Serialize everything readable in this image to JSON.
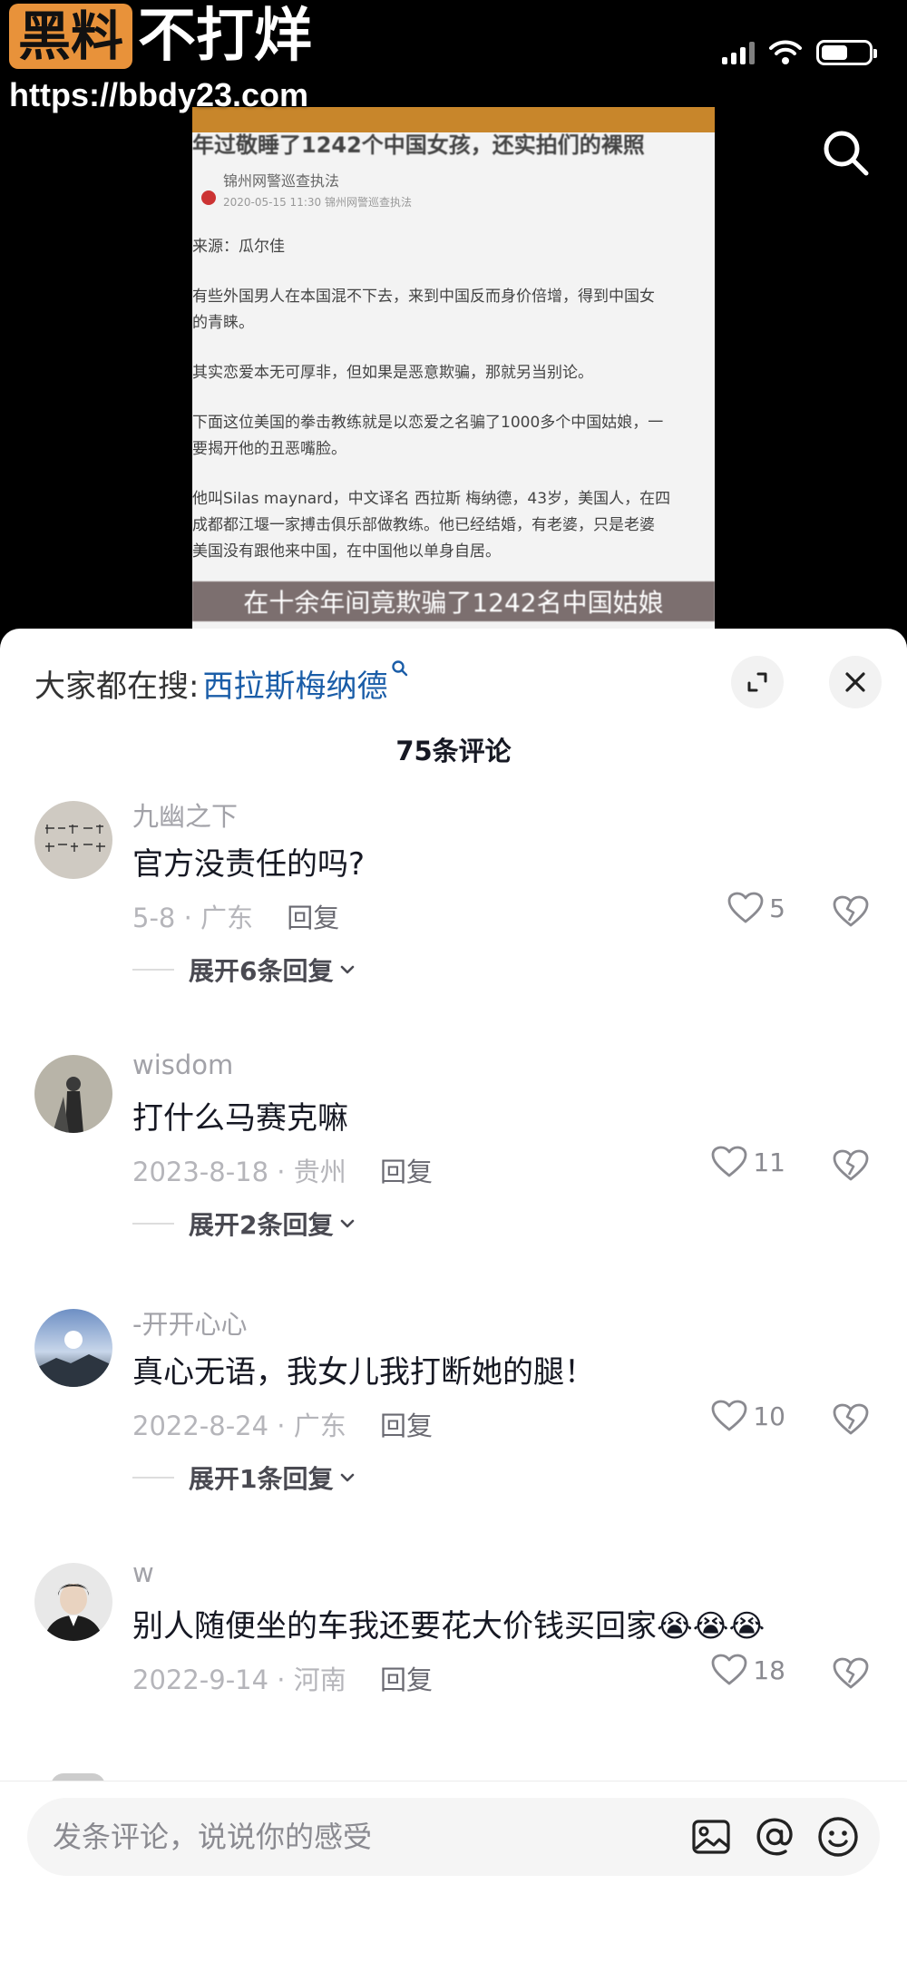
{
  "watermark": {
    "badge": "黑料",
    "brand": "不打烊",
    "url": "https://bbdy23.com"
  },
  "video": {
    "article": {
      "headline": "年过敬睡了1242个中国女孩，还实拍们的裸照",
      "author": "锦州网警巡查执法",
      "date": "2020-05-15 11:30    锦州网警巡查执法",
      "paragraphs": [
        "来源：瓜尔佳",
        "有些外国男人在本国混不下去，来到中国反而身价倍增，得到中国女",
        "的青睐。",
        "其实恋爱本无可厚非，但如果是恶意欺骗，那就另当别论。",
        "下面这位美国的拳击教练就是以恋爱之名骗了1000多个中国姑娘，一",
        "要揭开他的丑恶嘴脸。",
        "他叫Silas maynard，中文译名 西拉斯 梅纳德，43岁，美国人，在四",
        "成都都江堰一家搏击俱乐部做教练。他已经结婚，有老婆，只是老婆",
        "美国没有跟他来中国，在中国他以单身自居。"
      ],
      "caption": "在十余年间竟欺骗了1242名中国姑娘"
    }
  },
  "sheet": {
    "hot_search_label": "大家都在搜:",
    "hot_search_keyword": "西拉斯梅纳德",
    "count_label": "75条评论"
  },
  "comments": [
    {
      "user": "九幽之下",
      "text": "官方没责任的吗?",
      "date_loc": "5-8 · 广东",
      "reply": "回复",
      "likes": "5",
      "expand": "展开6条回复"
    },
    {
      "user": "wisdom",
      "text": "打什么马赛克嘛",
      "date_loc": "2023-8-18 · 贵州",
      "reply": "回复",
      "likes": "11",
      "expand": "展开2条回复"
    },
    {
      "user": "-开开心心",
      "text": "真心无语，我女儿我打断她的腿！",
      "date_loc": "2022-8-24 · 广东",
      "reply": "回复",
      "likes": "10",
      "expand": "展开1条回复"
    },
    {
      "user": "w",
      "text": "别人随便坐的车我还要花大价钱买回家😭😭😭",
      "date_loc": "2022-9-14 · 河南",
      "reply": "回复",
      "likes": "18"
    }
  ],
  "input": {
    "placeholder": "发条评论，说说你的感受"
  },
  "colors": {
    "accent_link": "#1a5da8",
    "watermark_badge": "#e8923a"
  },
  "icons": {
    "search": "search-icon",
    "expand": "expand-icon",
    "close": "close-icon",
    "like": "heart-icon",
    "dislike": "broken-heart-icon",
    "image": "image-icon",
    "mention": "at-icon",
    "emoji": "emoji-icon"
  }
}
